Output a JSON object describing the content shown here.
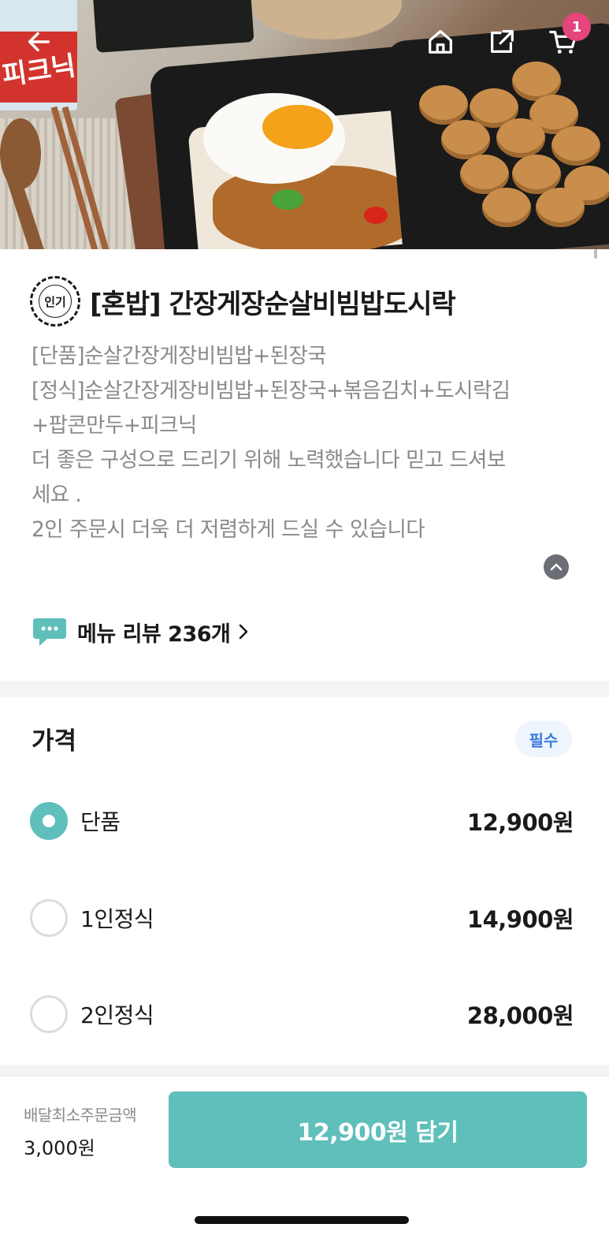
{
  "hero": {
    "cart_count": "1",
    "photo_label": "피크닉"
  },
  "menu": {
    "popular_badge": "인기",
    "title": "[혼밥] 간장게장순살비빔밥도시락",
    "description_lines": [
      "[단품]순살간장게장비빔밥+된장국",
      "[정식]순살간장게장비빔밥+된장국+볶음김치+도시락김",
      "+팝콘만두+피크닉",
      "더 좋은 구성으로 드리기 위해 노력했습니다 믿고 드셔보",
      "세요 .",
      "2인 주문시 더욱 더 저렴하게 드실 수 있습니다"
    ],
    "review_link": "메뉴 리뷰 236개"
  },
  "price_section": {
    "title": "가격",
    "required_badge": "필수",
    "options": [
      {
        "label": "단품",
        "price": "12,900원",
        "selected": true
      },
      {
        "label": "1인정식",
        "price": "14,900원",
        "selected": false
      },
      {
        "label": "2인정식",
        "price": "28,000원",
        "selected": false
      }
    ]
  },
  "bottom_bar": {
    "min_order_label": "배달최소주문금액",
    "min_order_value": "3,000원",
    "add_button": "12,900원 담기"
  },
  "colors": {
    "accent": "#5ebfbb",
    "badge_pink": "#e4457c",
    "required_blue": "#3b7be0"
  },
  "icons": [
    "back-arrow-icon",
    "home-icon",
    "share-icon",
    "cart-icon",
    "chevron-up-icon",
    "speech-bubble-icon",
    "chevron-right-icon"
  ]
}
